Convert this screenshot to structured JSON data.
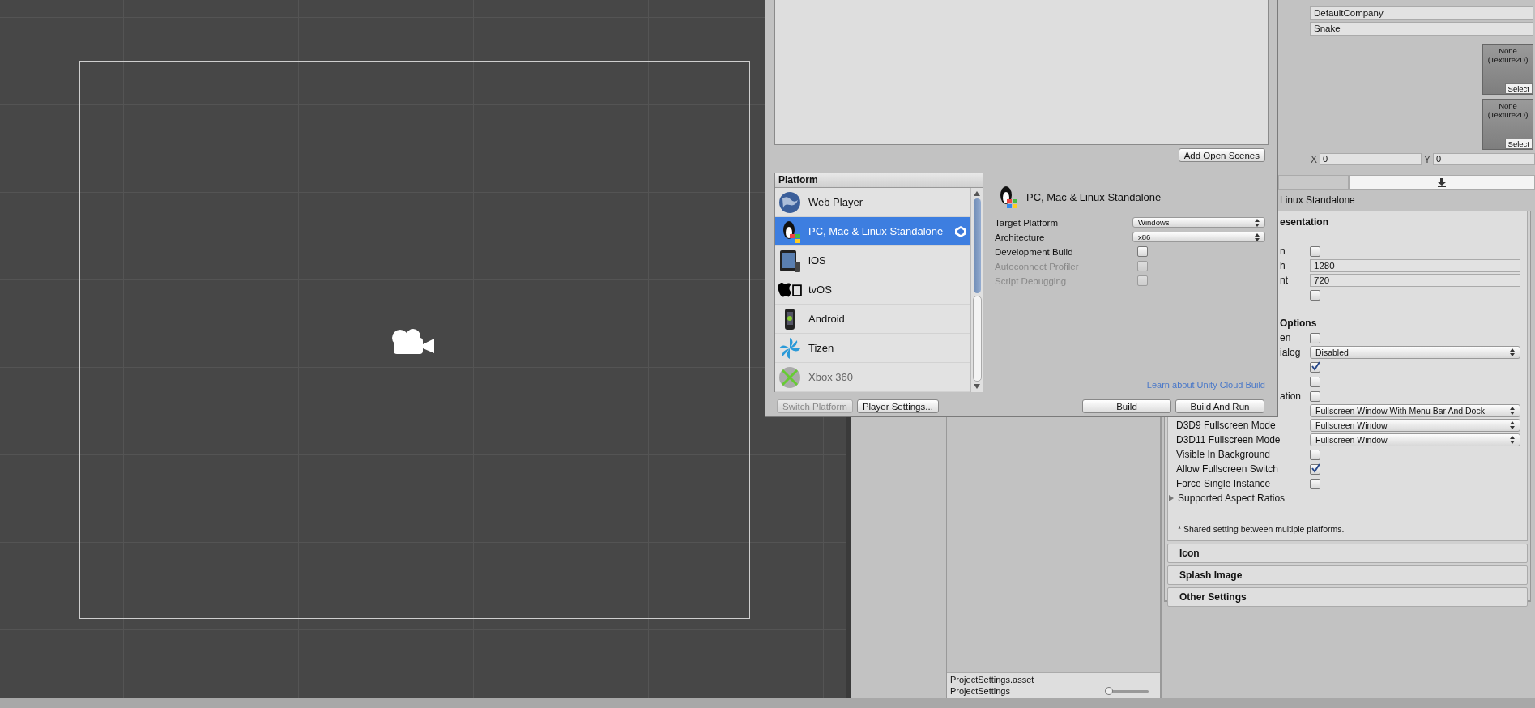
{
  "build_dialog": {
    "add_button": "Add Open Scenes",
    "platform_header": "Platform",
    "platforms": [
      {
        "name": "Web Player",
        "selected": false,
        "active": false,
        "disabled": false
      },
      {
        "name": "PC, Mac & Linux Standalone",
        "selected": true,
        "active": true,
        "disabled": false
      },
      {
        "name": "iOS",
        "selected": false,
        "active": false,
        "disabled": false
      },
      {
        "name": "tvOS",
        "selected": false,
        "active": false,
        "disabled": false
      },
      {
        "name": "Android",
        "selected": false,
        "active": false,
        "disabled": false
      },
      {
        "name": "Tizen",
        "selected": false,
        "active": false,
        "disabled": false
      },
      {
        "name": "Xbox 360",
        "selected": false,
        "active": false,
        "disabled": true
      }
    ],
    "detail_title": "PC, Mac & Linux Standalone",
    "options": [
      {
        "label": "Target Platform",
        "kind": "dropdown",
        "value": "Windows",
        "disabled": false
      },
      {
        "label": "Architecture",
        "kind": "dropdown",
        "value": "x86",
        "disabled": false
      },
      {
        "label": "Development Build",
        "kind": "checkbox",
        "checked": false,
        "disabled": false
      },
      {
        "label": "Autoconnect Profiler",
        "kind": "checkbox",
        "checked": false,
        "disabled": true
      },
      {
        "label": "Script Debugging",
        "kind": "checkbox",
        "checked": false,
        "disabled": true
      }
    ],
    "link": "Learn about Unity Cloud Build",
    "left_buttons": [
      {
        "label": "Switch Platform",
        "disabled": true
      },
      {
        "label": "Player Settings...",
        "disabled": false
      }
    ],
    "right_buttons": [
      {
        "label": "Build",
        "disabled": false
      },
      {
        "label": "Build And Run",
        "disabled": false
      }
    ]
  },
  "inspector": {
    "company_field": "DefaultCompany",
    "product_field": "Snake",
    "texture_slots": [
      {
        "text": "None (Texture2D)",
        "button": "Select"
      },
      {
        "text": "None (Texture2D)",
        "button": "Select"
      }
    ],
    "hotspot": {
      "x_label": "X",
      "x_value": "0",
      "y_label": "Y",
      "y_value": "0"
    },
    "tabs": [
      {
        "selected": false
      },
      {
        "selected": true
      }
    ],
    "platform_title": "Linux Standalone",
    "sections": [
      {
        "heading": "esentation",
        "covered": true,
        "rows": [
          {
            "kind": "spacer"
          },
          {
            "label": "n",
            "covered": true,
            "kind": "checkbox",
            "checked": false
          },
          {
            "label": "h",
            "covered": true,
            "kind": "text",
            "value": "1280"
          },
          {
            "label": "nt",
            "covered": true,
            "kind": "text",
            "value": "720"
          },
          {
            "kind": "checkbox",
            "checked": false
          }
        ]
      },
      {
        "heading": "Options",
        "covered": true,
        "rows": [
          {
            "label": "en",
            "covered": true,
            "kind": "checkbox",
            "checked": false
          },
          {
            "label": "ialog",
            "covered": true,
            "kind": "dropdown",
            "value": "Disabled"
          },
          {
            "kind": "checkbox",
            "checked": true
          },
          {
            "kind": "checkbox",
            "checked": false
          },
          {
            "label": "ation",
            "covered": true,
            "kind": "checkbox",
            "checked": false
          },
          {
            "kind": "dropdown",
            "value": "Fullscreen Window With Menu Bar And Dock"
          },
          {
            "label": "D3D9 Fullscreen Mode",
            "covered": false,
            "kind": "dropdown",
            "value": "Fullscreen Window"
          },
          {
            "label": "D3D11 Fullscreen Mode",
            "covered": false,
            "kind": "dropdown",
            "value": "Fullscreen Window"
          },
          {
            "label": "Visible In Background",
            "covered": false,
            "kind": "checkbox",
            "checked": false
          },
          {
            "label": "Allow Fullscreen Switch",
            "covered": false,
            "kind": "checkbox",
            "checked": true
          },
          {
            "label": "Force Single Instance",
            "covered": false,
            "kind": "checkbox",
            "checked": false
          },
          {
            "label": "Supported Aspect Ratios",
            "kind": "foldout",
            "expanded": false
          }
        ]
      }
    ],
    "note": "* Shared setting between multiple platforms.",
    "foldouts": [
      "Icon",
      "Splash Image",
      "Other Settings"
    ]
  },
  "project_panel": {
    "path": "ProjectSettings.asset",
    "name": "ProjectSettings",
    "zoom_slider": {
      "level": 0
    }
  }
}
